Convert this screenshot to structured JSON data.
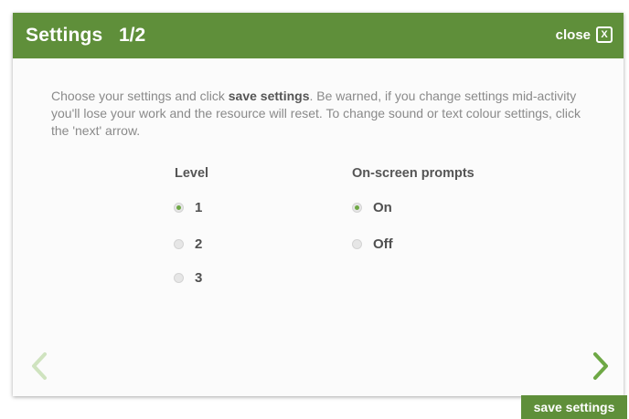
{
  "header": {
    "title": "Settings",
    "page": "1/2",
    "close_label": "close",
    "close_glyph": "X"
  },
  "intro": {
    "part1": "Choose your settings and click ",
    "bold": "save settings",
    "part2": ". Be warned, if you change settings mid-activity you'll lose your work and the resource will reset. To change sound or text colour settings, click the 'next' arrow."
  },
  "level": {
    "heading": "Level",
    "options": [
      {
        "label": "1",
        "selected": true
      },
      {
        "label": "2",
        "selected": false
      },
      {
        "label": "3",
        "selected": false
      }
    ]
  },
  "prompts": {
    "heading": "On-screen prompts",
    "options": [
      {
        "label": "On",
        "selected": true
      },
      {
        "label": "Off",
        "selected": false
      }
    ]
  },
  "nav": {
    "prev_icon": "chevron-left-icon",
    "next_icon": "chevron-right-icon"
  },
  "footer": {
    "save_label": "save settings"
  },
  "colors": {
    "brand_green": "#5f8f3a",
    "arrow_prev": "#cfe3bf",
    "arrow_next": "#6ea845"
  }
}
